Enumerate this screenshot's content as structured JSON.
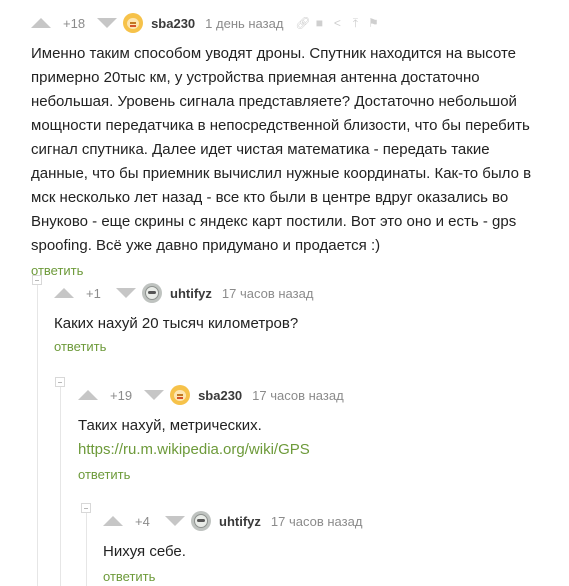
{
  "comments": [
    {
      "rating": "+18",
      "username": "sba230",
      "avatar": "sba230-avatar",
      "timestamp": "1 день назад",
      "body": "Именно таким способом уводят дроны. Спутник находится на высоте примерно 20тыс км, у устройства приемная антенна достаточно небольшая. Уровень сигнала представляете? Достаточно небольшой мощности передатчика в непосредственной близости, что бы перебить сигнал спутника. Далее идет чистая математика - передать такие данные, что бы приемник вычислил нужные координаты. Как-то было в мск несколько лет назад - все кто были в центре вдруг оказались во Внуково - еще скрины с яндекс карт постили. Вот это оно и есть - gps spoofing. Всё уже давно придумано и продается :)",
      "reply": "ответить",
      "actions": [
        "link-icon",
        "save-icon",
        "share-icon",
        "scroll-top-icon",
        "report-flag-icon"
      ]
    },
    {
      "rating": "+1",
      "username": "uhtifyz",
      "avatar": "uhtifyz-avatar",
      "timestamp": "17 часов назад",
      "body": "Каких нахуй 20 тысяч километров?",
      "reply": "ответить"
    },
    {
      "rating": "+19",
      "username": "sba230",
      "avatar": "sba230-avatar",
      "timestamp": "17 часов назад",
      "body": "Таких нахуй, метрических.",
      "link": "https://ru.m.wikipedia.org/wiki/GPS",
      "reply": "ответить"
    },
    {
      "rating": "+4",
      "username": "uhtifyz",
      "avatar": "uhtifyz-avatar",
      "timestamp": "17 часов назад",
      "body": "Нихуя себе.",
      "reply": "ответить"
    }
  ],
  "colors": {
    "accent": "#6d9a3a",
    "muted": "#8b8b8b",
    "vote_arrow": "#c6c6c6",
    "thread_line": "#e6e6e6"
  }
}
